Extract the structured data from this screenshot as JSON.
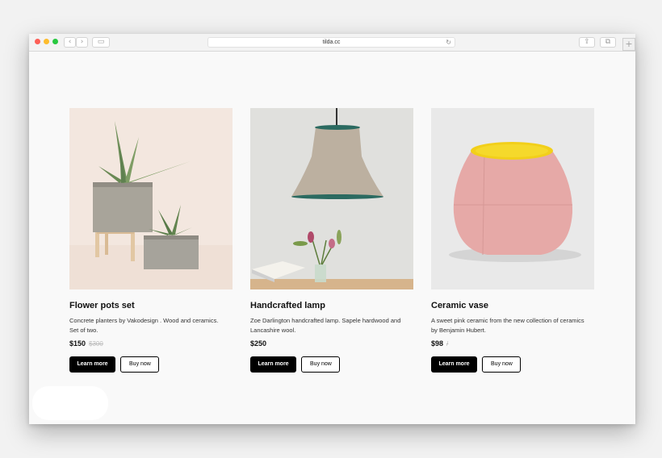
{
  "browser": {
    "url": "tilda.cc",
    "nav_back_icon": "‹",
    "nav_forward_icon": "›",
    "sidebar_icon": "▭",
    "share_icon": "⇪",
    "tabs_icon": "⧉",
    "reload_icon": "↻",
    "new_tab_icon": "+"
  },
  "products": [
    {
      "title": "Flower pots set",
      "description": "Concrete planters by Vakodesign . Wood and ceramics. Set of two.",
      "price": "$150",
      "old_price": "$300",
      "learn_more_label": "Learn more",
      "buy_now_label": "Buy now"
    },
    {
      "title": "Handcrafted lamp",
      "description": "Zoe Darlington handcrafted lamp. Sapele hardwood and Lancashire wool.",
      "price": "$250",
      "old_price": "",
      "learn_more_label": "Learn more",
      "buy_now_label": "Buy now"
    },
    {
      "title": "Ceramic vase",
      "description": "A sweet pink ceramic from the new collection of ceramics by Benjamin Hubert.",
      "price": "$98",
      "old_price": "/",
      "learn_more_label": "Learn more",
      "buy_now_label": "Buy now"
    }
  ],
  "colors": {
    "page_background": "#f9f9f9",
    "primary_button": "#000000",
    "old_price": "#bbbbbb"
  }
}
